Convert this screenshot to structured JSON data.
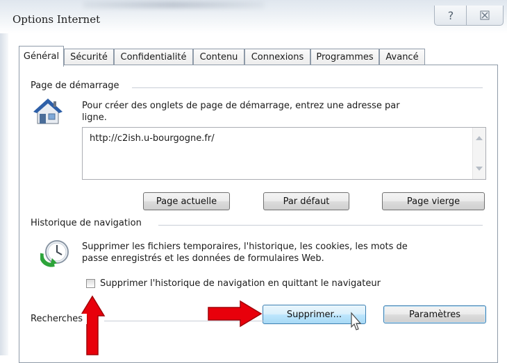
{
  "window": {
    "title": "Options Internet",
    "help_label": "?",
    "close_label": "☒"
  },
  "tabs": [
    {
      "label": "Général",
      "active": true
    },
    {
      "label": "Sécurité"
    },
    {
      "label": "Confidentialité"
    },
    {
      "label": "Contenu"
    },
    {
      "label": "Connexions"
    },
    {
      "label": "Programmes"
    },
    {
      "label": "Avancé"
    }
  ],
  "home": {
    "group_title": "Page de démarrage",
    "description_line1": "Pour créer des onglets de page de démarrage, entrez une adresse par",
    "description_line2": "ligne.",
    "url": "http://c2ish.u-bourgogne.fr/",
    "btn_current": "Page actuelle",
    "btn_default": "Par défaut",
    "btn_blank": "Page vierge"
  },
  "history": {
    "group_title": "Historique de navigation",
    "description_line1": "Supprimer les fichiers temporaires, l'historique, les cookies, les mots de",
    "description_line2": "passe enregistrés et les données de formulaires Web.",
    "checkbox_label": "Supprimer l'historique de navigation en quittant le navigateur",
    "checkbox_checked": false,
    "btn_delete": "Supprimer...",
    "btn_settings": "Paramètres"
  },
  "search": {
    "group_title": "Recherches"
  },
  "colors": {
    "accent_arrow": "#e8000b",
    "button_hot": "#bee6fd"
  }
}
